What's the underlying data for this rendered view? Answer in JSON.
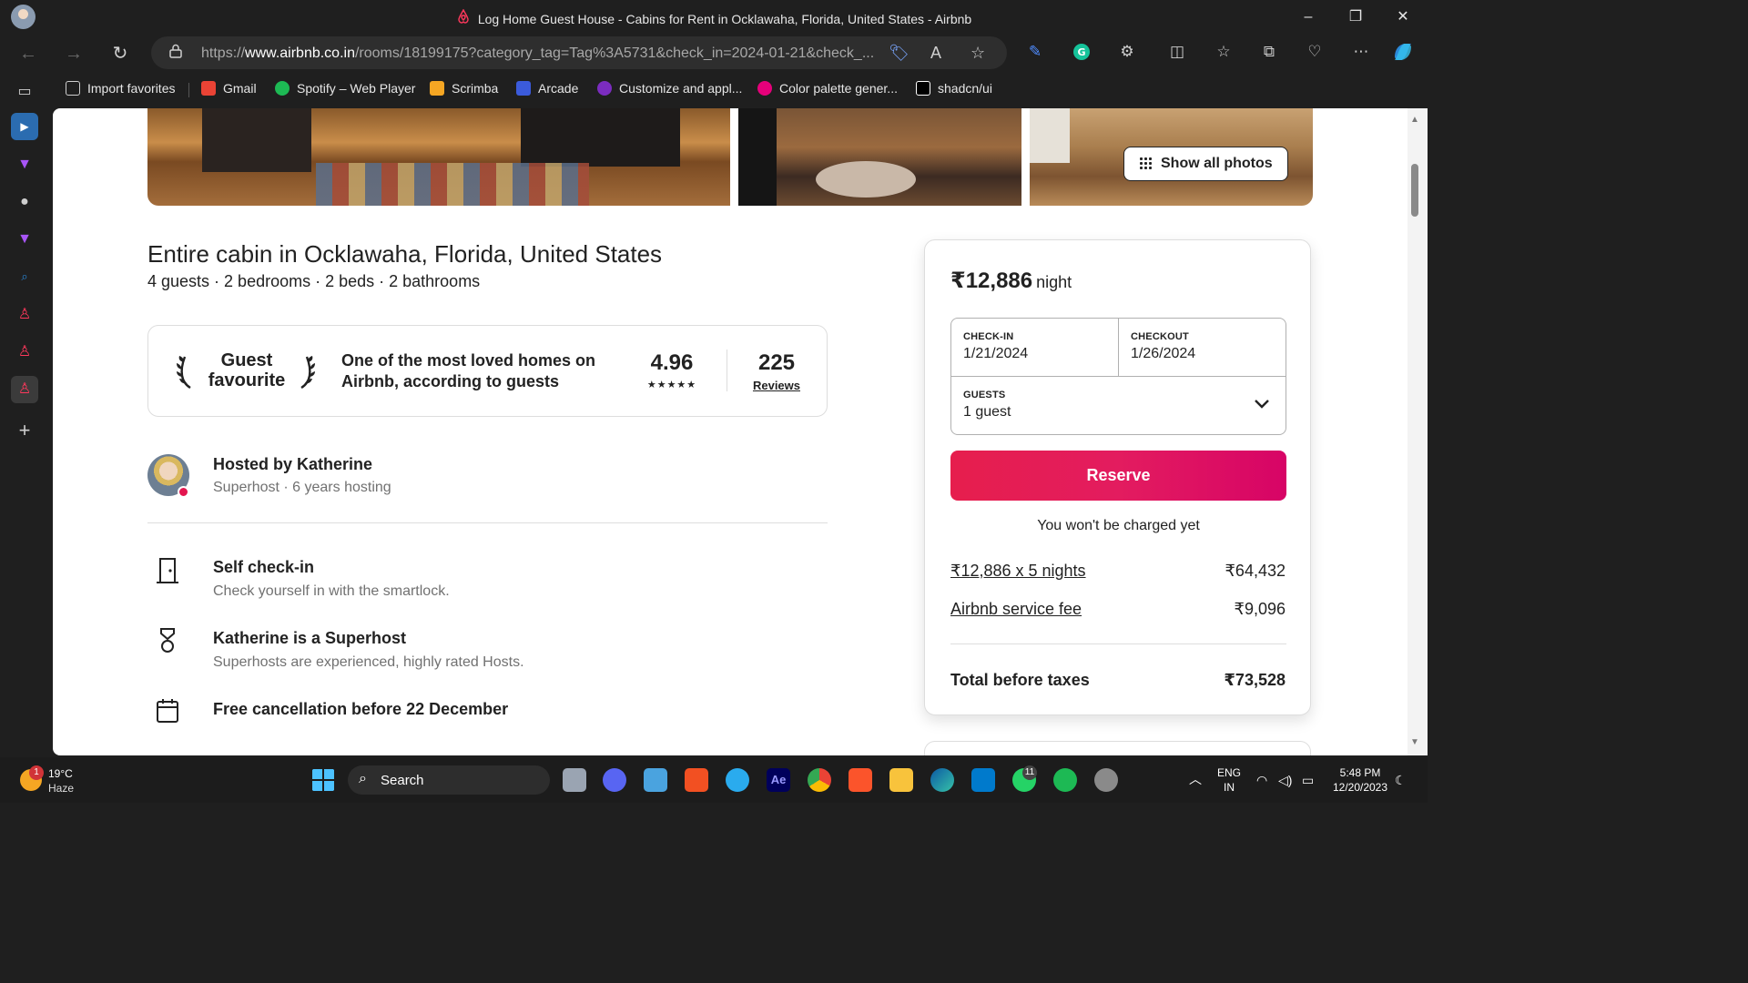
{
  "window": {
    "title": "Log Home Guest House - Cabins for Rent in Ocklawaha, Florida, United States - Airbnb"
  },
  "browser": {
    "url_prefix": "https://",
    "url_host": "www.airbnb.co.in",
    "url_rest": "/rooms/18199175?category_tag=Tag%3A5731&check_in=2024-01-21&check_..."
  },
  "bookmarks": [
    {
      "label": "Import favorites",
      "color": "#cfcfcf"
    },
    {
      "label": "Gmail",
      "color": "#ea4335"
    },
    {
      "label": "Spotify – Web Player",
      "color": "#1db954"
    },
    {
      "label": "Scrimba",
      "color": "#f5a623"
    },
    {
      "label": "Arcade",
      "color": "#3b5bdb"
    },
    {
      "label": "Customize and appl...",
      "color": "#7b2cbf"
    },
    {
      "label": "Color palette gener...",
      "color": "#e6007a"
    },
    {
      "label": "shadcn/ui",
      "color": "#ffffff"
    }
  ],
  "listing": {
    "show_all_photos": "Show all photos",
    "title": "Entire cabin in Ocklawaha, Florida, United States",
    "summary": "4 guests · 2 bedrooms · 2 beds · 2 bathrooms",
    "guest_favourite": {
      "label_line1": "Guest",
      "label_line2": "favourite",
      "description": "One of the most loved homes on Airbnb, according to guests",
      "rating": "4.96",
      "stars": "★★★★★",
      "review_count": "225",
      "reviews_label": "Reviews"
    },
    "host": {
      "title": "Hosted by Katherine",
      "subtitle": "Superhost · 6 years hosting"
    },
    "features": [
      {
        "title": "Self check-in",
        "subtitle": "Check yourself in with the smartlock.",
        "icon": "door-icon"
      },
      {
        "title": "Katherine is a Superhost",
        "subtitle": "Superhosts are experienced, highly rated Hosts.",
        "icon": "medal-icon"
      },
      {
        "title": "Free cancellation before 22 December",
        "subtitle": "",
        "icon": "calendar-icon"
      }
    ]
  },
  "booking": {
    "price": "₹12,886",
    "per": "night",
    "checkin_label": "CHECK-IN",
    "checkin_value": "1/21/2024",
    "checkout_label": "CHECKOUT",
    "checkout_value": "1/26/2024",
    "guests_label": "GUESTS",
    "guests_value": "1 guest",
    "reserve_label": "Reserve",
    "no_charge": "You won't be charged yet",
    "nights_label": "₹12,886 x 5 nights",
    "nights_value": "₹64,432",
    "fee_label": "Airbnb service fee",
    "fee_value": "₹9,096",
    "total_label": "Total before taxes",
    "total_value": "₹73,528",
    "accent": "#e31c5f"
  },
  "taskbar": {
    "weather_temp": "19°C",
    "weather_cond": "Haze",
    "weather_badge": "1",
    "search_label": "Search",
    "whatsapp_badge": "11",
    "lang_line1": "ENG",
    "lang_line2": "IN",
    "time": "5:48 PM",
    "date": "12/20/2023"
  }
}
